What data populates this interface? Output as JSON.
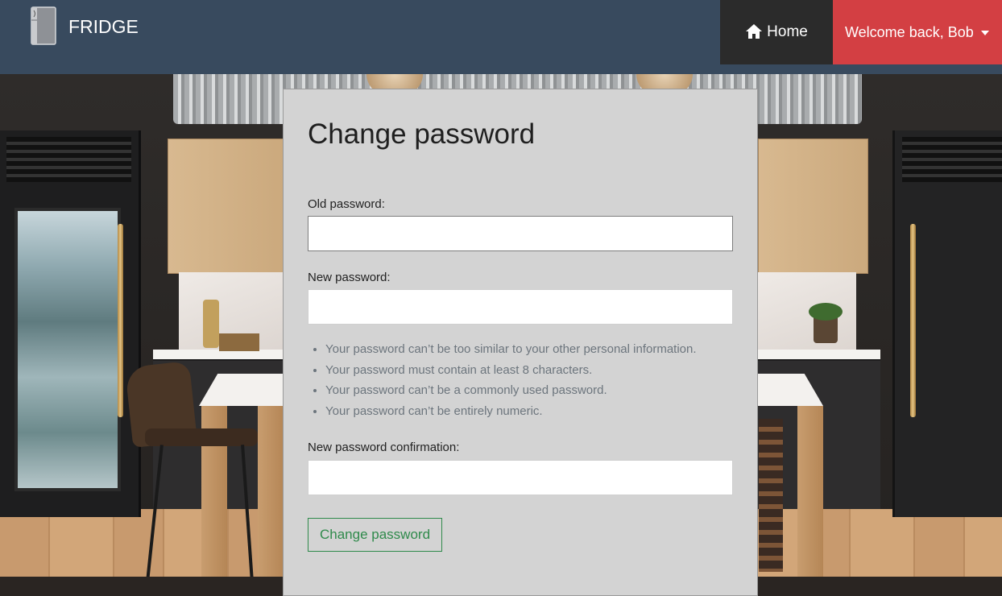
{
  "navbar": {
    "brand": "FRIDGE",
    "brand_icon": "fridge-icon",
    "home_label": "Home",
    "home_icon": "home-icon",
    "user_label": "Welcome back, Bob",
    "colors": {
      "navbar": "#384a5e",
      "home_bg": "#2b2b2b",
      "user_bg": "#d33f43"
    }
  },
  "form": {
    "title": "Change password",
    "old_password_label": "Old password:",
    "new_password_label": "New password:",
    "help_items": [
      "Your password can’t be too similar to your other personal information.",
      "Your password must contain at least 8 characters.",
      "Your password can’t be a commonly used password.",
      "Your password can’t be entirely numeric."
    ],
    "confirm_label": "New password confirmation:",
    "submit_label": "Change password",
    "colors": {
      "card_bg": "#d3d3d3",
      "button": "#2f8a4b"
    }
  }
}
